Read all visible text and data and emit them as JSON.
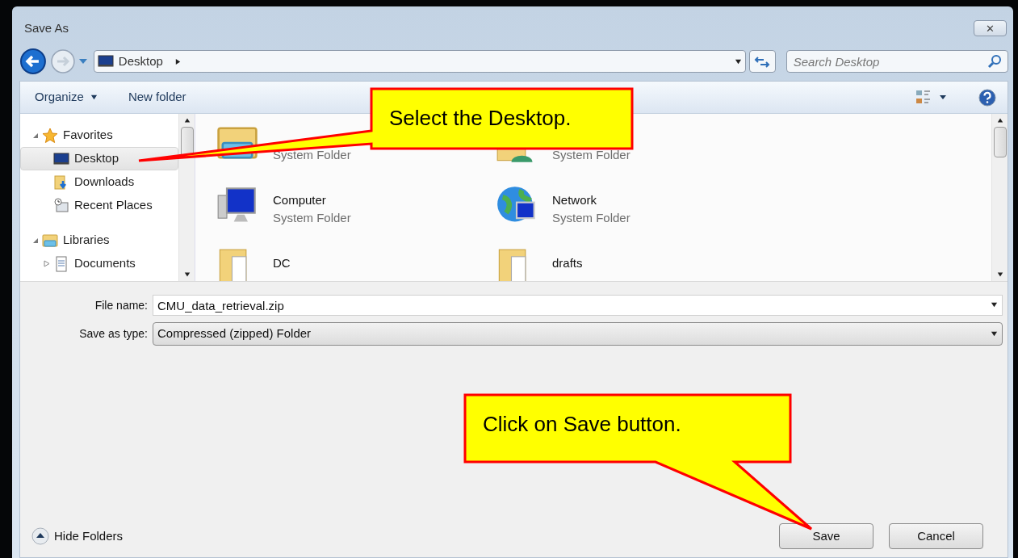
{
  "window": {
    "title": "Save As",
    "close": "✕"
  },
  "address": {
    "location": "Desktop",
    "search_placeholder": "Search Desktop"
  },
  "toolbar": {
    "organize": "Organize",
    "new_folder": "New folder"
  },
  "nav": [
    {
      "label": "Favorites",
      "expanded": true,
      "selected": false,
      "children": [
        {
          "label": "Desktop",
          "selected": true
        },
        {
          "label": "Downloads",
          "selected": false
        },
        {
          "label": "Recent Places",
          "selected": false
        }
      ]
    },
    {
      "label": "Libraries",
      "expanded": true,
      "selected": false,
      "children": [
        {
          "label": "Documents",
          "selected": false,
          "expanded": false
        }
      ]
    }
  ],
  "files": [
    {
      "type": "System Folder"
    },
    {
      "type": "System Folder"
    },
    {
      "name": "Computer",
      "type": "System Folder"
    },
    {
      "name": "Network",
      "type": "System Folder"
    },
    {
      "name": "DC"
    },
    {
      "name": "drafts"
    }
  ],
  "form": {
    "file_name_label": "File name:",
    "file_name": "CMU_data_retrieval.zip",
    "type_label": "Save as type:",
    "type": "Compressed (zipped) Folder"
  },
  "footer": {
    "hide_folders": "Hide Folders",
    "save": "Save",
    "cancel": "Cancel"
  },
  "callouts": [
    {
      "text": "Select the Desktop."
    },
    {
      "text": "Click on Save button."
    }
  ]
}
